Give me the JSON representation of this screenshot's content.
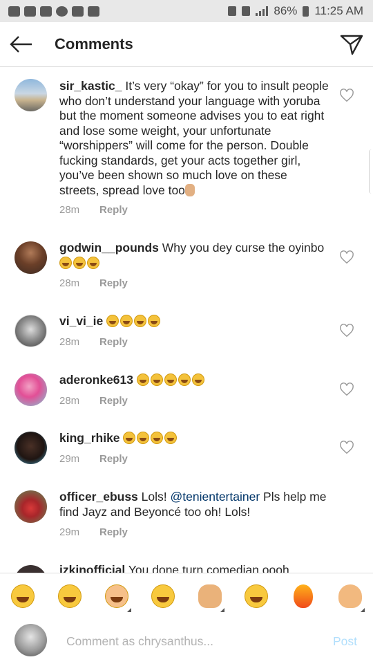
{
  "status_bar": {
    "battery": "86%",
    "time": "11:25 AM"
  },
  "header": {
    "title": "Comments"
  },
  "comments": [
    {
      "username": "sir_kastic_",
      "text": "It’s very “okay” for you to insult people who don’t understand your language with yoruba but the moment someone advises you to eat right and lose some weight, your unfortunate “worshippers” will come for the person. Double fucking standards, get your acts together girl, you’ve been shown so much love on these streets, spread love too",
      "emoji": [
        "victory-hand"
      ],
      "time": "28m",
      "reply": "Reply"
    },
    {
      "username": "godwin__pounds",
      "text": "Why you dey curse the oyinbo",
      "emoji": [
        "laughing-face",
        "laughing-face",
        "laughing-face"
      ],
      "time": "28m",
      "reply": "Reply"
    },
    {
      "username": "vi_vi_ie",
      "text": "",
      "emoji": [
        "laughing-face",
        "laughing-face",
        "laughing-face",
        "laughing-face"
      ],
      "time": "28m",
      "reply": "Reply"
    },
    {
      "username": "aderonke613",
      "text": "",
      "emoji": [
        "laughing-face",
        "laughing-face",
        "laughing-face",
        "laughing-face",
        "laughing-face"
      ],
      "time": "28m",
      "reply": "Reply"
    },
    {
      "username": "king_rhike",
      "text": "",
      "emoji": [
        "rolling-laughing-face",
        "rolling-laughing-face",
        "rolling-laughing-face",
        "rolling-laughing-face"
      ],
      "time": "29m",
      "reply": "Reply"
    },
    {
      "username": "officer_ebuss",
      "text_before": "Lols!",
      "mention": "@tenientertainer",
      "text_after": "Pls help me find Jayz and Beyoncé too oh! Lols!",
      "time": "29m",
      "reply": "Reply"
    },
    {
      "username": "izkinofficial",
      "text": "You done turn comedian oooh"
    }
  ],
  "reactions": [
    "tears-of-joy-face",
    "rolling-laughing-face",
    "smiling-face-with-hands",
    "grinning-face",
    "raised-hand",
    "relieved-face",
    "fire",
    "ok-hand"
  ],
  "composer": {
    "placeholder": "Comment as chrysanthus...",
    "post_label": "Post"
  },
  "colors": {
    "mention": "#003569",
    "meta": "#999999",
    "post_disabled": "#b2dffc"
  }
}
